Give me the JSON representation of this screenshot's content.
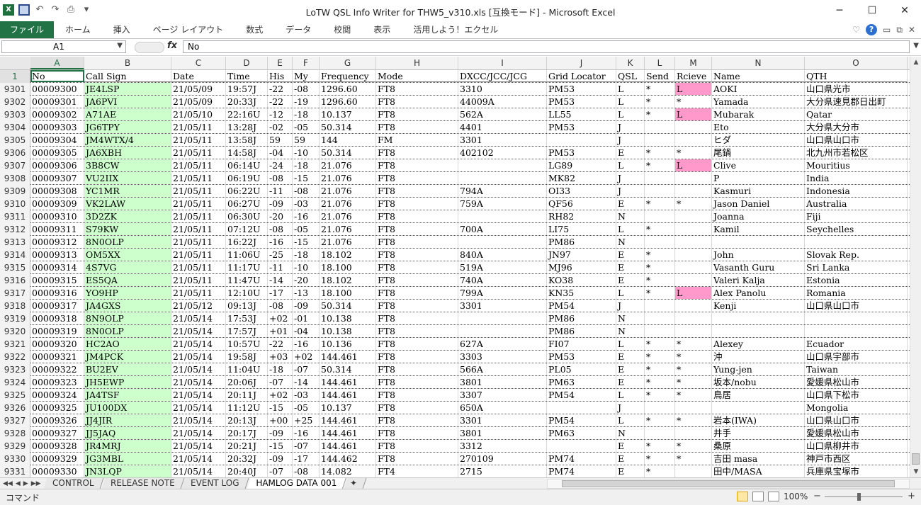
{
  "window": {
    "title": "LoTW QSL Info Writer for THW5_v310.xls  [互換モード]  -  Microsoft Excel",
    "controls": [
      "─",
      "☐",
      "✕"
    ]
  },
  "ribbon": {
    "tabs": [
      "ファイル",
      "ホーム",
      "挿入",
      "ページ レイアウト",
      "数式",
      "データ",
      "校閲",
      "表示",
      "活用しよう！エクセル"
    ]
  },
  "formula_bar": {
    "name_box": "A1",
    "fx": "fx",
    "content": "No"
  },
  "columns": [
    {
      "letter": "A",
      "w": 76
    },
    {
      "letter": "B",
      "w": 123
    },
    {
      "letter": "C",
      "w": 77
    },
    {
      "letter": "D",
      "w": 59
    },
    {
      "letter": "E",
      "w": 35
    },
    {
      "letter": "F",
      "w": 38
    },
    {
      "letter": "G",
      "w": 80
    },
    {
      "letter": "H",
      "w": 116
    },
    {
      "letter": "I",
      "w": 125
    },
    {
      "letter": "J",
      "w": 98
    },
    {
      "letter": "K",
      "w": 40
    },
    {
      "letter": "L",
      "w": 43
    },
    {
      "letter": "M",
      "w": 52
    },
    {
      "letter": "N",
      "w": 131
    },
    {
      "letter": "O",
      "w": 145
    }
  ],
  "header_row": {
    "num": "1",
    "cells": [
      "No",
      "Call Sign",
      "Date",
      "Time",
      "His",
      "My",
      "Frequency",
      "Mode",
      "DXCC/JCC/JCG",
      "Grid Locator",
      "QSL",
      "Send",
      "Rcieve",
      "Name",
      "QTH"
    ]
  },
  "rows": [
    {
      "num": "9301",
      "cells": [
        "00009300",
        "JE4LSP",
        "21/05/09",
        "19:57J",
        "-22",
        "-08",
        "1296.60",
        "FT8",
        "3310",
        "PM53",
        "L",
        "*",
        "L",
        "AOKI",
        "山口県光市"
      ],
      "pink": true
    },
    {
      "num": "9302",
      "cells": [
        "00009301",
        "JA6PVI",
        "21/05/09",
        "20:33J",
        "-22",
        "-19",
        "1296.60",
        "FT8",
        "44009A",
        "PM53",
        "L",
        "*",
        "*",
        "Yamada",
        "大分県速見郡日出町"
      ],
      "pink": false
    },
    {
      "num": "9303",
      "cells": [
        "00009302",
        "A71AE",
        "21/05/10",
        "22:16U",
        "-12",
        "-18",
        "10.137",
        "FT8",
        "562A",
        "LL55",
        "L",
        "*",
        "L",
        "Mubarak",
        "Qatar"
      ],
      "pink": true
    },
    {
      "num": "9304",
      "cells": [
        "00009303",
        "JG6TPY",
        "21/05/11",
        "13:28J",
        "-02",
        "-05",
        "50.314",
        "FT8",
        "4401",
        "PM53",
        "J",
        "",
        "",
        "Eto",
        "大分県大分市"
      ],
      "pink": false
    },
    {
      "num": "9305",
      "cells": [
        "00009304",
        "JM4WTX/4",
        "21/05/11",
        "13:58J",
        "59",
        "59",
        "144",
        "FM",
        "3301",
        "",
        "J",
        "",
        "",
        "ヒダ",
        "山口県山口市"
      ],
      "pink": false
    },
    {
      "num": "9306",
      "cells": [
        "00009305",
        "JA6XBH",
        "21/05/11",
        "14:58J",
        "-04",
        "-10",
        "50.314",
        "FT8",
        "402102",
        "PM53",
        "E",
        "*",
        "*",
        "尾鍋",
        "北九州市若松区"
      ],
      "pink": false
    },
    {
      "num": "9307",
      "cells": [
        "00009306",
        "3B8CW",
        "21/05/11",
        "06:14U",
        "-24",
        "-18",
        "21.076",
        "FT8",
        "",
        "LG89",
        "L",
        "*",
        "L",
        "Clive",
        "Mouritius"
      ],
      "pink": true
    },
    {
      "num": "9308",
      "cells": [
        "00009307",
        "VU2IIX",
        "21/05/11",
        "06:19U",
        "-08",
        "-15",
        "21.076",
        "FT8",
        "",
        "MK82",
        "J",
        "",
        "",
        "P",
        "India"
      ],
      "pink": false
    },
    {
      "num": "9309",
      "cells": [
        "00009308",
        "YC1MR",
        "21/05/11",
        "06:22U",
        "-11",
        "-08",
        "21.076",
        "FT8",
        "794A",
        "OI33",
        "J",
        "",
        "",
        "Kasmuri",
        "Indonesia"
      ],
      "pink": false
    },
    {
      "num": "9310",
      "cells": [
        "00009309",
        "VK2LAW",
        "21/05/11",
        "06:27U",
        "-09",
        "-03",
        "21.076",
        "FT8",
        "759A",
        "QF56",
        "E",
        "*",
        "*",
        "Jason Daniel",
        "Australia"
      ],
      "pink": false
    },
    {
      "num": "9311",
      "cells": [
        "00009310",
        "3D2ZK",
        "21/05/11",
        "06:30U",
        "-20",
        "-16",
        "21.076",
        "FT8",
        "",
        "RH82",
        "N",
        "",
        "",
        "Joanna",
        "Fiji"
      ],
      "pink": false
    },
    {
      "num": "9312",
      "cells": [
        "00009311",
        "S79KW",
        "21/05/11",
        "07:12U",
        "-08",
        "-05",
        "21.076",
        "FT8",
        "700A",
        "LI75",
        "L",
        "*",
        "",
        "Kamil",
        "Seychelles"
      ],
      "pink": false
    },
    {
      "num": "9313",
      "cells": [
        "00009312",
        "8N0OLP",
        "21/05/11",
        "16:22J",
        "-16",
        "-15",
        "21.076",
        "FT8",
        "",
        "PM86",
        "N",
        "",
        "",
        "",
        ""
      ],
      "pink": false
    },
    {
      "num": "9314",
      "cells": [
        "00009313",
        "OM5XX",
        "21/05/11",
        "11:06U",
        "-25",
        "-18",
        "18.102",
        "FT8",
        "840A",
        "JN97",
        "E",
        "*",
        "",
        "John",
        "Slovak Rep."
      ],
      "pink": false
    },
    {
      "num": "9315",
      "cells": [
        "00009314",
        "4S7VG",
        "21/05/11",
        "11:17U",
        "-11",
        "-10",
        "18.100",
        "FT8",
        "519A",
        "MJ96",
        "E",
        "*",
        "",
        "Vasanth Guru",
        "Sri Lanka"
      ],
      "pink": false
    },
    {
      "num": "9316",
      "cells": [
        "00009315",
        "ES5QA",
        "21/05/11",
        "11:47U",
        "-14",
        "-20",
        "18.102",
        "FT8",
        "740A",
        "KO38",
        "E",
        "*",
        "",
        "Valeri Kalja",
        "Estonia"
      ],
      "pink": false
    },
    {
      "num": "9317",
      "cells": [
        "00009316",
        "YO9HP",
        "21/05/11",
        "12:10U",
        "-17",
        "-13",
        "18.100",
        "FT8",
        "799A",
        "KN35",
        "L",
        "*",
        "L",
        "Alex Panolu",
        "Romania"
      ],
      "pink": true
    },
    {
      "num": "9318",
      "cells": [
        "00009317",
        "JA4GXS",
        "21/05/12",
        "09:13J",
        "-08",
        "-09",
        "50.314",
        "FT8",
        "3301",
        "PM54",
        "J",
        "",
        "",
        "Kenji",
        "山口県山口市"
      ],
      "pink": false
    },
    {
      "num": "9319",
      "cells": [
        "00009318",
        "8N9OLP",
        "21/05/14",
        "17:53J",
        "+02",
        "-01",
        "10.138",
        "FT8",
        "",
        "PM86",
        "N",
        "",
        "",
        "",
        ""
      ],
      "pink": false
    },
    {
      "num": "9320",
      "cells": [
        "00009319",
        "8N0OLP",
        "21/05/14",
        "17:57J",
        "+01",
        "-04",
        "10.138",
        "FT8",
        "",
        "PM86",
        "N",
        "",
        "",
        "",
        ""
      ],
      "pink": false
    },
    {
      "num": "9321",
      "cells": [
        "00009320",
        "HC2AO",
        "21/05/14",
        "10:57U",
        "-22",
        "-16",
        "10.136",
        "FT8",
        "627A",
        "FI07",
        "L",
        "*",
        "*",
        "Alexey",
        "Ecuador"
      ],
      "pink": false
    },
    {
      "num": "9322",
      "cells": [
        "00009321",
        "JM4PCK",
        "21/05/14",
        "19:58J",
        "+03",
        "+02",
        "144.461",
        "FT8",
        "3303",
        "PM53",
        "E",
        "*",
        "*",
        "沖",
        "山口県宇部市"
      ],
      "pink": false
    },
    {
      "num": "9323",
      "cells": [
        "00009322",
        "BU2EV",
        "21/05/14",
        "11:04U",
        "-18",
        "-07",
        "50.314",
        "FT8",
        "566A",
        "PL05",
        "E",
        "*",
        "*",
        "Yung-jen",
        "Taiwan"
      ],
      "pink": false
    },
    {
      "num": "9324",
      "cells": [
        "00009323",
        "JH5EWP",
        "21/05/14",
        "20:06J",
        "-07",
        "-14",
        "144.461",
        "FT8",
        "3801",
        "PM63",
        "E",
        "*",
        "*",
        "坂本/nobu",
        "愛媛県松山市"
      ],
      "pink": false
    },
    {
      "num": "9325",
      "cells": [
        "00009324",
        "JA4TSF",
        "21/05/14",
        "20:11J",
        "+02",
        "-03",
        "144.461",
        "FT8",
        "3307",
        "PM54",
        "L",
        "*",
        "*",
        "鳥居",
        "山口県下松市"
      ],
      "pink": false
    },
    {
      "num": "9326",
      "cells": [
        "00009325",
        "JU100DX",
        "21/05/14",
        "11:12U",
        "-15",
        "-05",
        "10.137",
        "FT8",
        "650A",
        "",
        "J",
        "",
        "",
        "",
        "Mongolia"
      ],
      "pink": false
    },
    {
      "num": "9327",
      "cells": [
        "00009326",
        "JJ4JIR",
        "21/05/14",
        "20:13J",
        "+00",
        "+25",
        "144.461",
        "FT8",
        "3301",
        "PM54",
        "L",
        "*",
        "*",
        "岩本(IWA)",
        "山口県山口市"
      ],
      "pink": false
    },
    {
      "num": "9328",
      "cells": [
        "00009327",
        "JJ5JAQ",
        "21/05/14",
        "20:17J",
        "-09",
        "-16",
        "144.461",
        "FT8",
        "3801",
        "PM63",
        "N",
        "",
        "",
        "井手",
        "愛媛県松山市"
      ],
      "pink": false
    },
    {
      "num": "9329",
      "cells": [
        "00009328",
        "JR4MRJ",
        "21/05/14",
        "20:21J",
        "-15",
        "-07",
        "144.461",
        "FT8",
        "3312",
        "",
        "E",
        "*",
        "*",
        "桑原",
        "山口県柳井市"
      ],
      "pink": false
    },
    {
      "num": "9330",
      "cells": [
        "00009329",
        "JG3MBL",
        "21/05/14",
        "20:32J",
        "-09",
        "-17",
        "144.462",
        "FT8",
        "270109",
        "PM74",
        "E",
        "*",
        "*",
        "吉田 masa",
        "神戸市西区"
      ],
      "pink": false
    },
    {
      "num": "9331",
      "cells": [
        "00009330",
        "JN3LQP",
        "21/05/14",
        "20:40J",
        "-07",
        "-08",
        "14.082",
        "FT4",
        "2715",
        "PM74",
        "E",
        "*",
        "",
        "田中/MASA",
        "兵庫県宝塚市"
      ],
      "pink": false
    }
  ],
  "sheets": {
    "nav": [
      "◀◀",
      "◀",
      "▶",
      "▶▶"
    ],
    "tabs": [
      "CONTROL",
      "RELEASE NOTE",
      "EVENT LOG",
      "HAMLOG DATA 001"
    ],
    "active": 3
  },
  "status_bar": {
    "mode": "コマンド",
    "zoom": "100%",
    "zoom_level_percent": 100,
    "zoom_minus": "−",
    "zoom_plus": "+"
  },
  "colors": {
    "excel_green": "#217346",
    "callsign_fill": "#ccffcc",
    "rcieve_fill": "#ff99cc"
  }
}
